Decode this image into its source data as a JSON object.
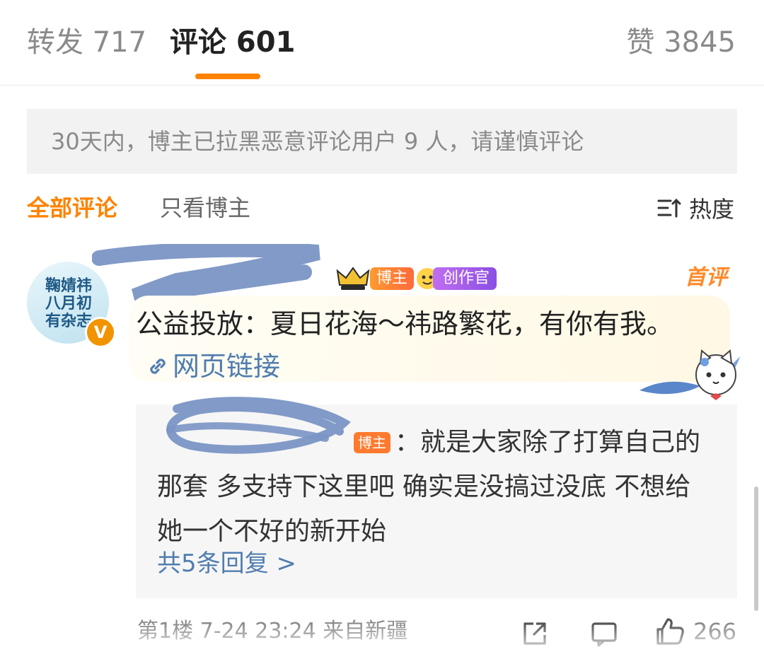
{
  "tabs": {
    "repost": "转发 717",
    "comment": "评论 601",
    "like": "赞 3845"
  },
  "notice": "30天内，博主已拉黑恶意评论用户 9 人，请谨慎评论",
  "filters": {
    "all": "全部评论",
    "owner_only": "只看博主",
    "sort": "热度"
  },
  "comment": {
    "avatar_text": "鞠婧祎八月初有杂志",
    "verified_badge": "V",
    "badges": {
      "blogger": "博主",
      "creator": "创作官"
    },
    "first_comment_label": "首评",
    "text": "公益投放：夏日花海～祎路繁花，有你有我。",
    "link_label": "网页链接",
    "reply": {
      "badge": "博主",
      "text": "：就是大家除了打算自己的那套 多支持下这里吧  确实是没搞过没底 不想给她一个不好的新开始",
      "more": "共5条回复 >"
    },
    "meta": "第1楼 7-24 23:24 来自新疆",
    "like_count": "266"
  },
  "icons": {
    "sort": "sort-icon",
    "link": "link-icon",
    "share": "share-icon",
    "comment": "comment-icon",
    "like": "thumbs-up-icon",
    "crown": "crown-icon",
    "mascot": "cat-mascot-icon"
  },
  "colors": {
    "accent": "#ff8200",
    "link": "#507daf",
    "scribble": "#7a95c4"
  }
}
